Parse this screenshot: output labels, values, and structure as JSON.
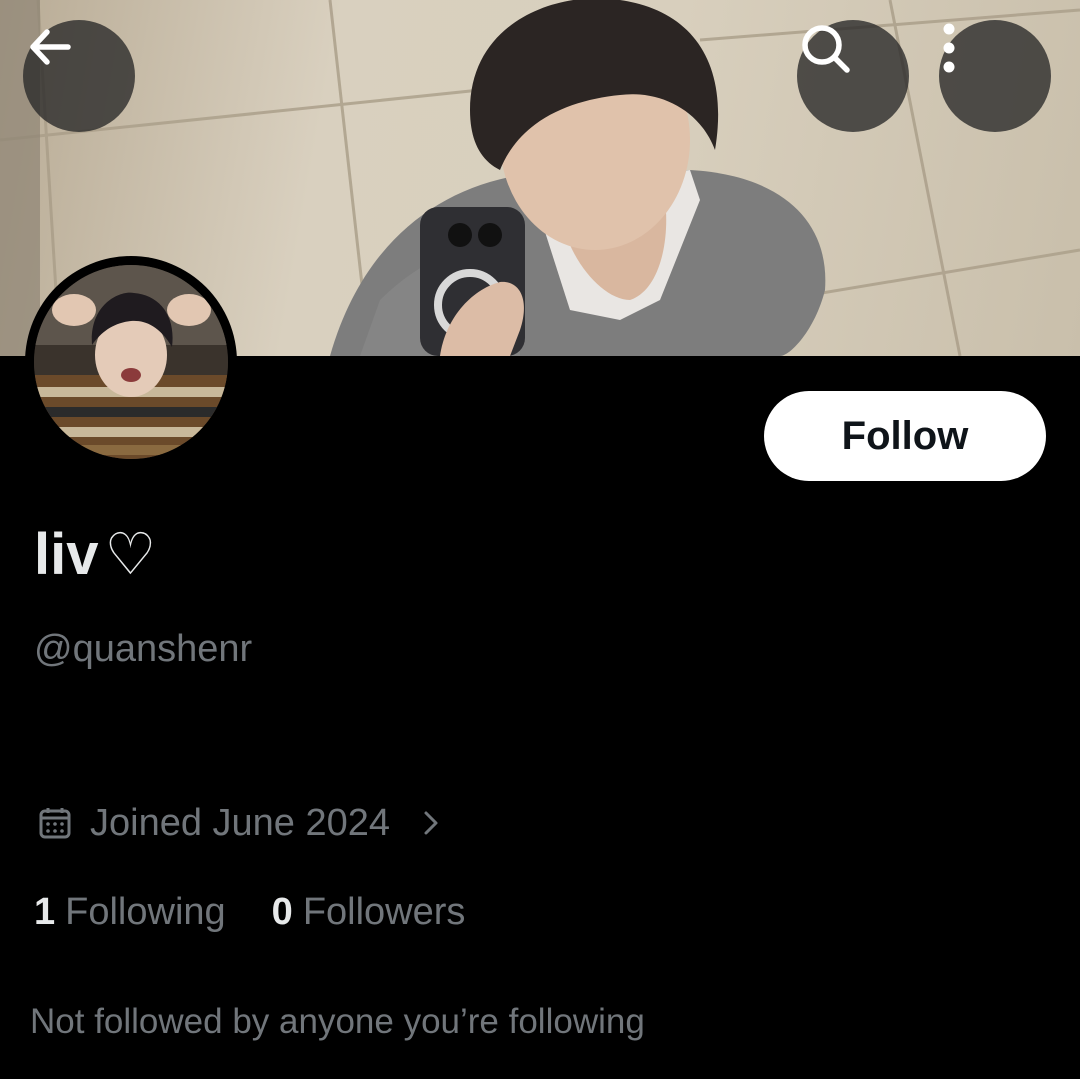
{
  "header": {
    "back_icon": "arrow-left-icon",
    "search_icon": "search-icon",
    "more_icon": "more-vertical-icon"
  },
  "profile": {
    "display_name": "liv",
    "name_emoji": "♡",
    "handle": "@quanshenr",
    "follow_label": "Follow",
    "joined_text": "Joined June 2024",
    "following_count": "1",
    "following_label": "Following",
    "followers_count": "0",
    "followers_label": "Followers",
    "mutuals_text": "Not followed by anyone you’re following"
  },
  "colors": {
    "background": "#000000",
    "primary_text": "#e7e9ea",
    "secondary_text": "#71767b",
    "follow_button_bg": "#ffffff",
    "follow_button_text": "#0f1419"
  }
}
